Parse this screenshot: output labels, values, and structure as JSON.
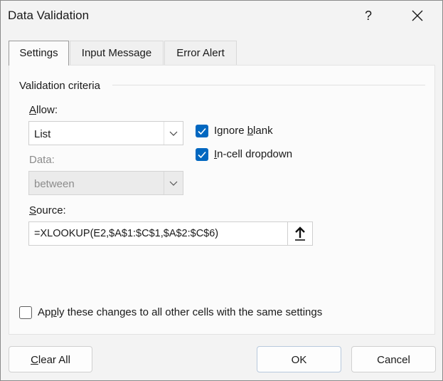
{
  "dialog": {
    "title": "Data Validation",
    "help_label": "?"
  },
  "tabs": [
    {
      "label": "Settings",
      "active": true
    },
    {
      "label": "Input Message",
      "active": false
    },
    {
      "label": "Error Alert",
      "active": false
    }
  ],
  "settings": {
    "group_label": "Validation criteria",
    "allow_label_pre": "",
    "allow_label_key": "A",
    "allow_label_post": "llow:",
    "allow_value": "List",
    "data_label": "Data:",
    "data_value": "between",
    "ignore_blank": {
      "pre": "Ignore ",
      "key": "b",
      "post": "lank",
      "checked": true
    },
    "in_cell_dropdown": {
      "pre": "",
      "key": "I",
      "post": "n-cell dropdown",
      "checked": true
    },
    "source_label_key": "S",
    "source_label_post": "ource:",
    "source_value": "=XLOOKUP(E2,$A$1:$C$1,$A$2:$C$6)",
    "apply_all": {
      "pre": "Ap",
      "key": "p",
      "post": "ly these changes to all other cells with the same settings",
      "checked": false
    }
  },
  "buttons": {
    "clear_key": "C",
    "clear_post": "lear All",
    "ok": "OK",
    "cancel": "Cancel"
  },
  "colors": {
    "accent": "#0067c0",
    "dialog_bg": "#f3f3f3",
    "panel_bg": "#fbfbfb"
  }
}
